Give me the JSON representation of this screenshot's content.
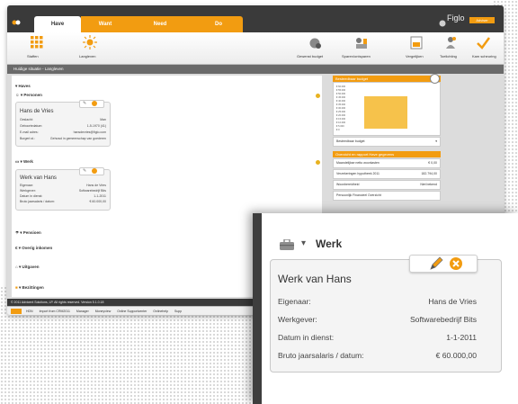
{
  "header": {
    "tabs": [
      {
        "label": "Have",
        "active": true
      },
      {
        "label": "Want",
        "active": false
      },
      {
        "label": "Need",
        "active": false
      },
      {
        "label": "Do",
        "active": false
      }
    ],
    "logo_text": "Figlo",
    "logo_badge": "Adviser"
  },
  "toolbar": {
    "left_items": [
      "Staffen",
      "Langleven"
    ],
    "right_items": [
      "Gewenst budget",
      "Sparen/ontsparen",
      "Vergelijken",
      "Toelichting",
      "Kam scheuring"
    ]
  },
  "breadcrumb": "Huidige situatie - Langleven",
  "content": {
    "haves_label": "Haves",
    "personen_label": "Personen",
    "person_card": {
      "title": "Hans de Vries",
      "rows": [
        {
          "label": "Geslacht:",
          "value": "Man"
        },
        {
          "label": "Geboortedatum:",
          "value": "1-5-1970 (41)"
        },
        {
          "label": "E-mail adres:",
          "value": "hansdevries@figlo.com"
        },
        {
          "label": "Burgerl.st.:",
          "value": "Gehuwd in gemeenschap van goederen"
        }
      ]
    },
    "werk_label": "Werk",
    "werk_card": {
      "title": "Werk van Hans",
      "rows": [
        {
          "label": "Eigenaar:",
          "value": "Hans de Vries"
        },
        {
          "label": "Werkgever:",
          "value": "Softwarebedrijf Bits"
        },
        {
          "label": "Datum in dienst:",
          "value": "1-1-2011"
        },
        {
          "label": "Bruto jaarsalaris / datum:",
          "value": "€ 60.000,00"
        }
      ]
    },
    "more_sections": [
      "Pensioen",
      "Overig inkomen",
      "Uitgaven",
      "Bezittingen"
    ]
  },
  "sidebar": {
    "budget_title": "Besteedbaar budget",
    "y_ticks": [
      "€ 60.000",
      "€ 55.000",
      "€ 50.000",
      "€ 45.000",
      "€ 40.000",
      "€ 35.000",
      "€ 30.000",
      "€ 25.000",
      "€ 20.000",
      "€ 15.000",
      "€ 10.000",
      "€ 5.000",
      "€ 0"
    ],
    "budget_select": "Besteedbaar budget",
    "overview_title": "Overzicht en rapport Have gegevens",
    "overview_rows": [
      {
        "label": "Maandelijkse netto woonlasten",
        "value": "€ 0,00"
      },
      {
        "label": "Verzekeringen hypotheek 2011",
        "value": "182.794,00"
      },
      {
        "label": "Woonbereidheid",
        "value": "Niet bekend"
      },
      {
        "label": "Persoonlijk Financieel Overzicht",
        "value": ""
      }
    ]
  },
  "footer": "© 2011 Advicent Solutions, LP. All rights reserved. Version 5.1.0.18",
  "statusbar": [
    "HDN",
    "Import from CRM2011",
    "Manager",
    "Moneyview",
    "Online Supportcenter",
    "Onlinehelp",
    "Supp"
  ],
  "zoom": {
    "section_label": "Werk",
    "card_title": "Werk van Hans",
    "rows": [
      {
        "label": "Eigenaar:",
        "value": "Hans de Vries"
      },
      {
        "label": "Werkgever:",
        "value": "Softwarebedrijf Bits"
      },
      {
        "label": "Datum in dienst:",
        "value": "1-1-2011"
      },
      {
        "label": "Bruto jaarsalaris / datum:",
        "value": "€ 60.000,00"
      }
    ]
  },
  "colors": {
    "accent": "#f29c11",
    "dark": "#3a3a3a",
    "card": "#f4f4f4"
  }
}
